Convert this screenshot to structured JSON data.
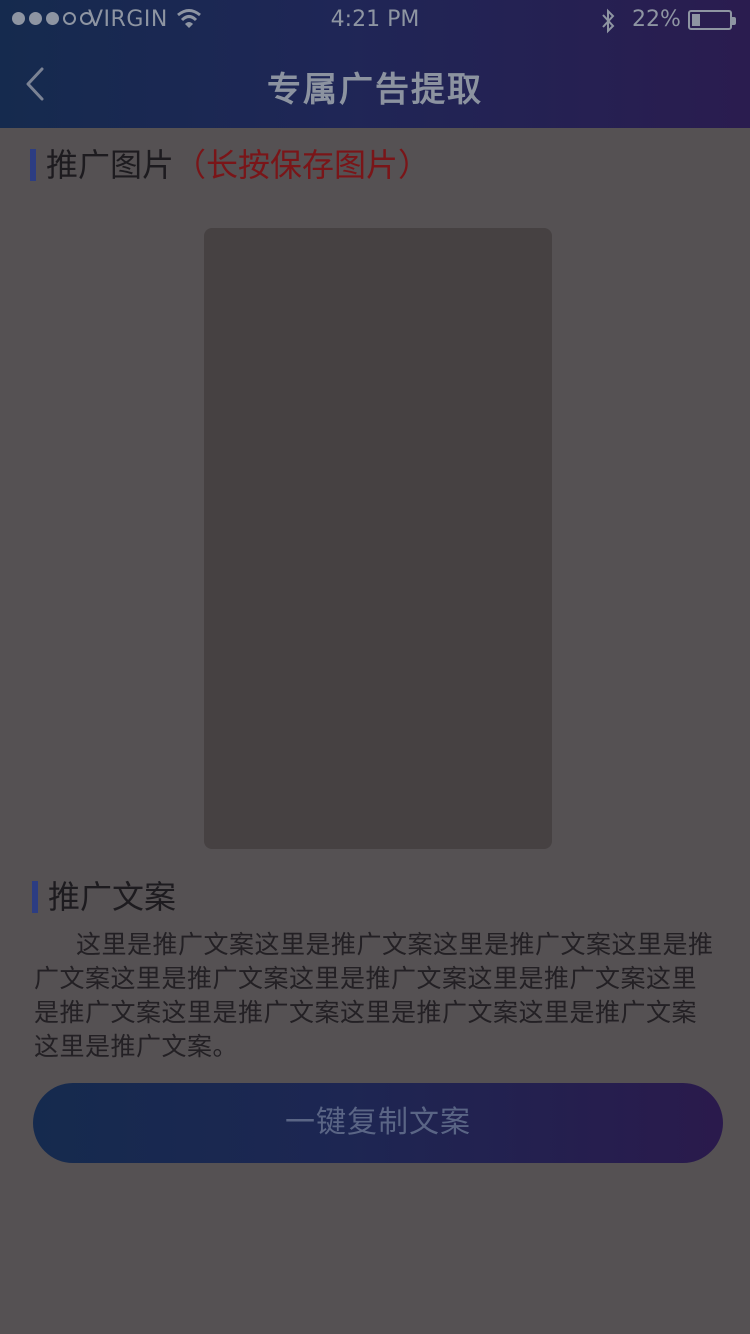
{
  "status_bar": {
    "signal_filled": 3,
    "signal_total": 5,
    "carrier": "VIRGIN",
    "time": "4:21 PM",
    "battery_percent": "22%",
    "battery_level": 0.22
  },
  "header": {
    "title": "专属广告提取",
    "back_icon": "chevron-left-icon"
  },
  "image_section": {
    "title": "推广图片",
    "hint": "（长按保存图片）"
  },
  "copy_section": {
    "title": "推广文案",
    "text": "这里是推广文案这里是推广文案这里是推广文案这里是推广文案这里是推广文案这里是推广文案这里是推广文案这里是推广文案这里是推广文案这里是推广文案这里是推广文案这里是推广文案。"
  },
  "actions": {
    "copy_button_label": "一键复制文案"
  },
  "colors": {
    "overlay_background": "#555153",
    "header_gradient_start": "#152a4e",
    "header_gradient_end": "#2a1c4f",
    "hint_red": "#7a1518",
    "accent_bar": "#2c3d82"
  }
}
